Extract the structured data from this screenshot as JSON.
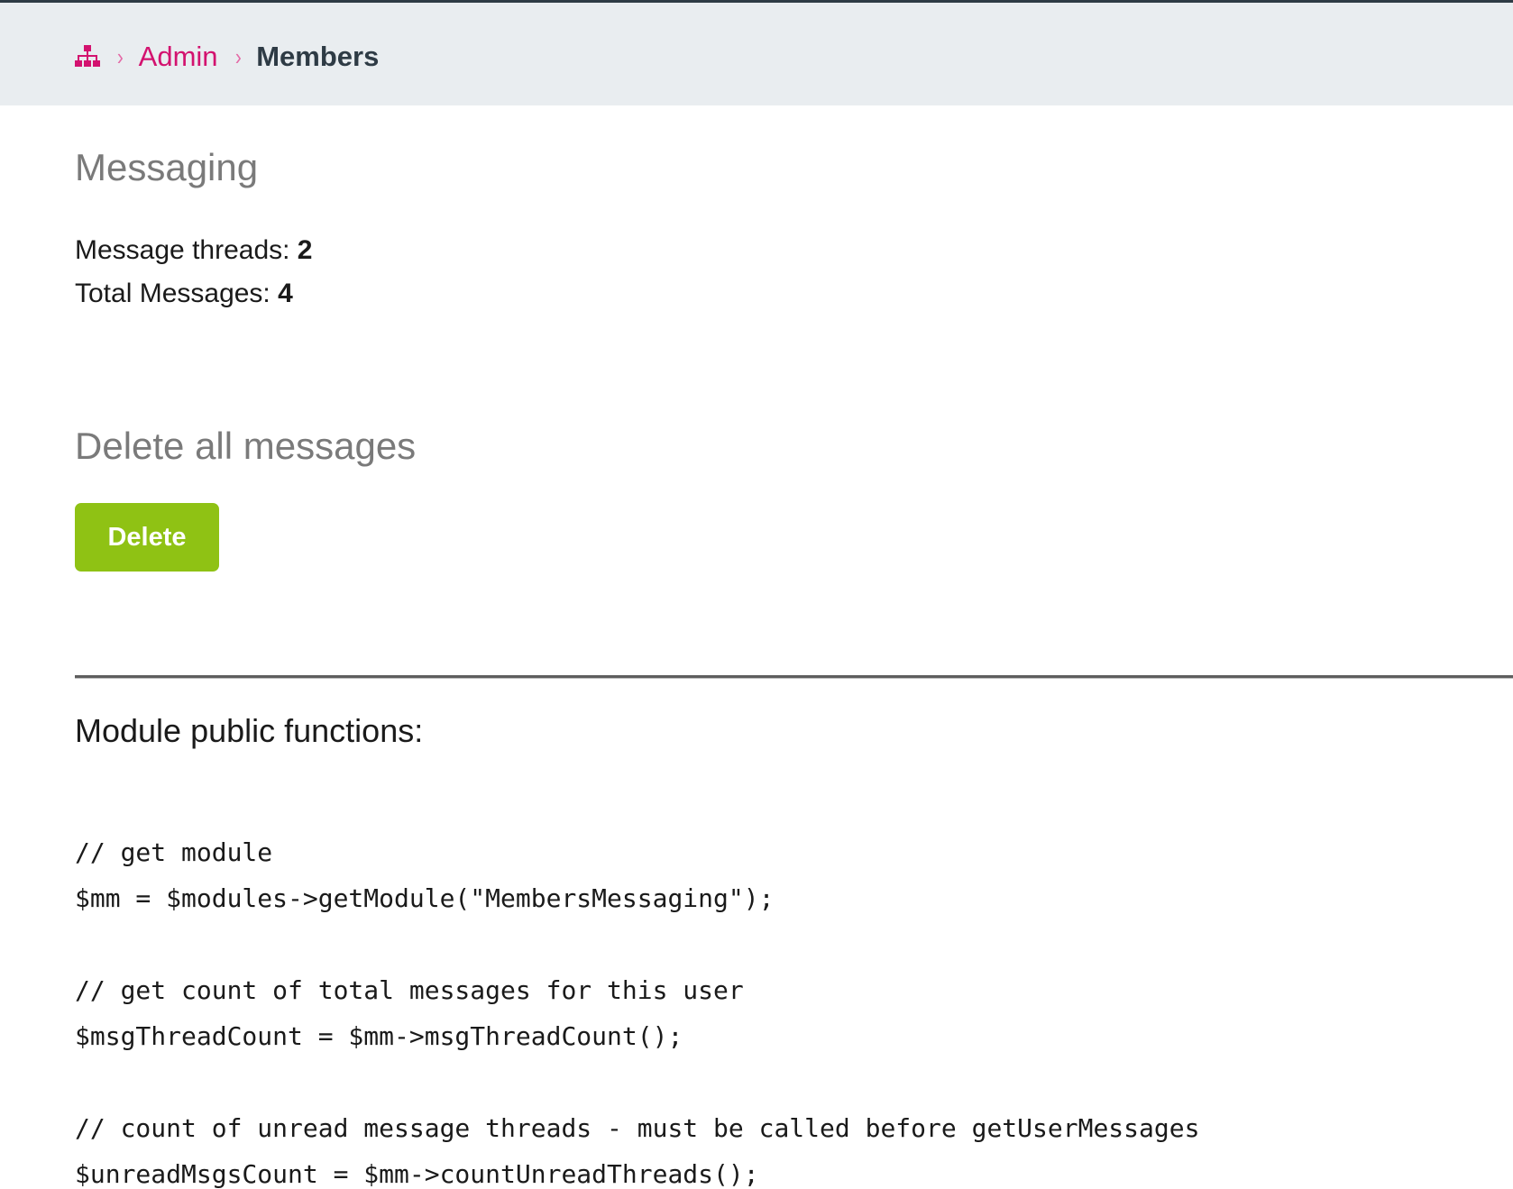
{
  "breadcrumb": {
    "home_icon": "sitemap-icon",
    "admin_label": "Admin",
    "current_label": "Members",
    "separator": "›"
  },
  "messaging": {
    "heading": "Messaging",
    "threads_label": "Message threads: ",
    "threads_value": "2",
    "total_label": "Total Messages: ",
    "total_value": "4"
  },
  "delete_section": {
    "heading": "Delete all messages",
    "button_label": "Delete"
  },
  "module": {
    "heading": "Module public functions:",
    "code_lines": [
      "// get module",
      "$mm = $modules->getModule(\"MembersMessaging\");",
      "// get count of total messages for this user",
      "$msgThreadCount = $mm->msgThreadCount();",
      "// count of unread message threads - must be called before getUserMessages",
      "$unreadMsgsCount = $mm->countUnreadThreads();"
    ]
  },
  "colors": {
    "accent_pink": "#d3126f",
    "button_green": "#8fc214",
    "topbar_bg": "#e9edf0",
    "heading_gray": "#7a7a7a"
  }
}
